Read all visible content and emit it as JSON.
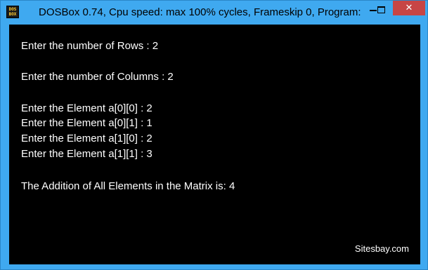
{
  "window": {
    "title": "DOSBox 0.74, Cpu speed: max 100% cycles, Frameskip  0, Program:",
    "icon_label_top": "DOS",
    "icon_label_bottom": "BOX",
    "close_symbol": "✕"
  },
  "console": {
    "lines": [
      "Enter the number of Rows : 2",
      "Enter the number of Columns : 2",
      "Enter the Element a[0][0] : 2",
      "Enter the Element a[0][1] : 1",
      "Enter the Element a[1][0] : 2",
      "Enter the Element a[1][1] : 3",
      "The Addition of All Elements in the Matrix is: 4"
    ],
    "watermark": "Sitesbay.com"
  },
  "colors": {
    "titlebar": "#3fa9f0",
    "close_button": "#c74545",
    "console_bg": "#000000",
    "console_text": "#ffffff"
  }
}
